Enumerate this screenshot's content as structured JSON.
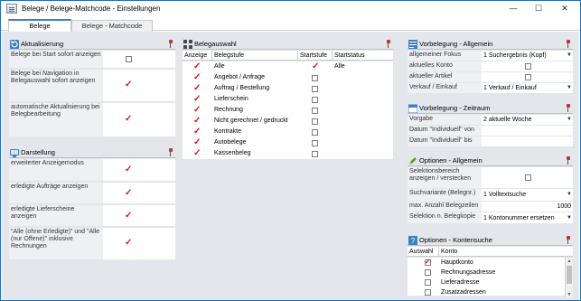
{
  "window": {
    "title": "Belege / Belege-Matchcode - Einstellungen",
    "minimize": "—",
    "maximize": "☐",
    "close": "✕"
  },
  "tabs": [
    {
      "label": "Belege"
    },
    {
      "label": "Belege - Matchcode"
    }
  ],
  "aktualisierung": {
    "title": "Aktualisierung",
    "rows": [
      {
        "label": "Belege bei Start sofort anzeigen",
        "checked": false
      },
      {
        "label": "Belege bei Navigation in Belegauswahl sofort anzeigen",
        "checked": true
      },
      {
        "label": "automatische Aktualisierung bei Belegbearbeitung",
        "checked": true
      }
    ]
  },
  "darstellung": {
    "title": "Darstellung",
    "rows": [
      {
        "label": "erweiterter Anzeigemodus",
        "checked": true
      },
      {
        "label": "erledigte Aufträge anzeigen",
        "checked": true
      },
      {
        "label": "erledigte Lieferscheine anzeigen",
        "checked": true
      },
      {
        "label": "\"Alle (ohne Erledigte)\" und \"Alle (nur Offene)\" inklusive Rechnungen",
        "checked": true
      }
    ]
  },
  "belegauswahl": {
    "title": "Belegauswahl",
    "columns": [
      "Anzeige",
      "Belegstufe",
      "Startstufe",
      "Startstatus"
    ],
    "rows": [
      {
        "anzeige": true,
        "stufe": "Alle",
        "start": true,
        "status": "Alle"
      },
      {
        "anzeige": true,
        "stufe": "Angebot / Anfrage",
        "start": false,
        "status": ""
      },
      {
        "anzeige": true,
        "stufe": "Auftrag / Bestellung",
        "start": false,
        "status": ""
      },
      {
        "anzeige": true,
        "stufe": "Lieferschein",
        "start": false,
        "status": ""
      },
      {
        "anzeige": true,
        "stufe": "Rechnung",
        "start": false,
        "status": ""
      },
      {
        "anzeige": true,
        "stufe": "Nicht gerechnet / gedruckt",
        "start": false,
        "status": ""
      },
      {
        "anzeige": true,
        "stufe": "Kontrakte",
        "start": false,
        "status": ""
      },
      {
        "anzeige": true,
        "stufe": "Autobelege",
        "start": false,
        "status": ""
      },
      {
        "anzeige": true,
        "stufe": "Kassenbeleg",
        "start": false,
        "status": ""
      }
    ]
  },
  "vorbelegung_allgemein": {
    "title": "Vorbelegung - Allgemein",
    "fokus_label": "allgemeiner Fokus",
    "fokus_value": "1  Suchergebnis (Kopf)",
    "konto_label": "aktuelles Konto",
    "konto_checked": false,
    "artikel_label": "aktueller Artikel",
    "artikel_checked": false,
    "verkauf_label": "Verkauf / Einkauf",
    "verkauf_value": "1  Verkauf / Einkauf"
  },
  "vorbelegung_zeitraum": {
    "title": "Vorbelegung - Zeitraum",
    "vorgabe_label": "Vorgabe",
    "vorgabe_value": "2  aktuelle Woche",
    "von_label": "Datum \"Individuell\" von",
    "bis_label": "Datum \"Individuell\" bis"
  },
  "optionen_allgemein": {
    "title": "Optionen - Allgemein",
    "selektion_label": "Selektionsbereich anzeigen / verstecken",
    "selektion_checked": false,
    "suchvariante_label": "Suchvariante (Belegnr.)",
    "suchvariante_value": "1  Volltextsuche",
    "max_label": "max. Anzahl Belegzeilen",
    "max_value": "1000",
    "kopie_label": "Selektion n. Belegkopie",
    "kopie_value": "1  Kontonummer ersetzen"
  },
  "optionen_kontensuche": {
    "title": "Optionen - Kontensuche",
    "columns": [
      "Auswahl",
      "Konto"
    ],
    "rows": [
      {
        "checked": true,
        "konto": "Hauptkonto"
      },
      {
        "checked": false,
        "konto": "Rechnungsadresse"
      },
      {
        "checked": false,
        "konto": "Lieferadresse"
      },
      {
        "checked": false,
        "konto": "Zusatzadressen"
      }
    ]
  },
  "colors": {
    "accent": "#3c7fc1",
    "check": "#d6141c",
    "panel_bg": "#e3e6ea"
  }
}
